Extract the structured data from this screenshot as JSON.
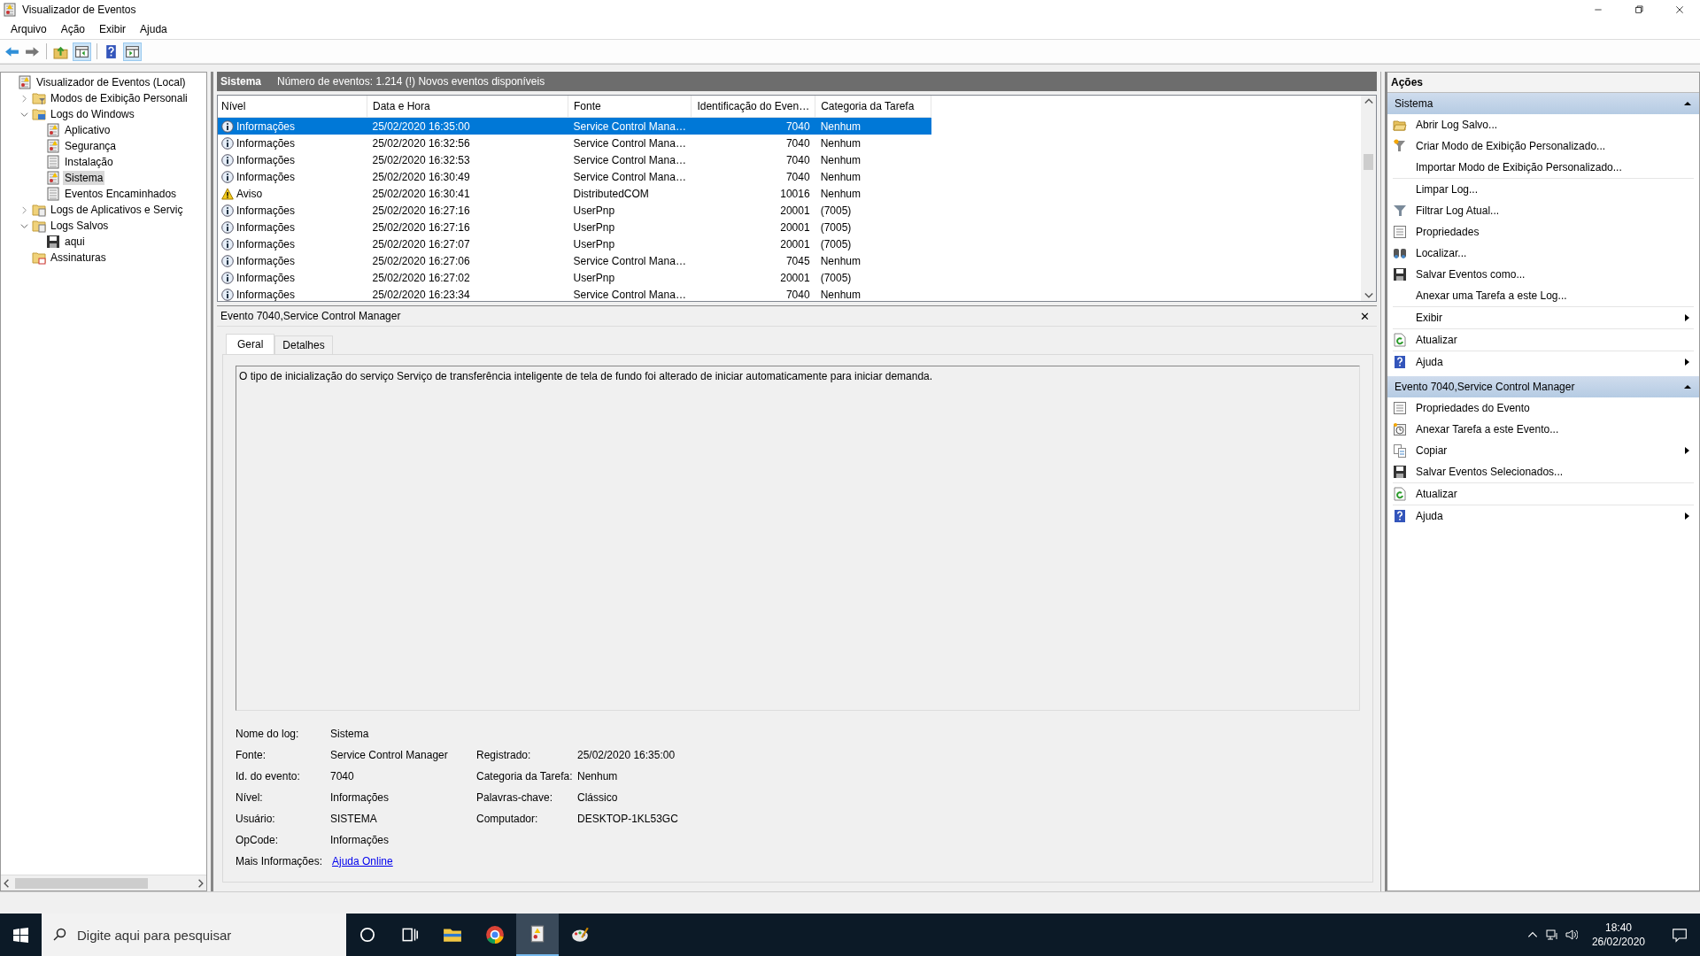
{
  "window": {
    "title": "Visualizador de Eventos"
  },
  "menu": [
    "Arquivo",
    "Ação",
    "Exibir",
    "Ajuda"
  ],
  "toolbar": [
    {
      "kind": "back"
    },
    {
      "kind": "forward"
    },
    {
      "kind": "sep"
    },
    {
      "kind": "folderup"
    },
    {
      "kind": "panelleft"
    },
    {
      "kind": "sep"
    },
    {
      "kind": "help"
    },
    {
      "kind": "panelright"
    }
  ],
  "tree": [
    {
      "label": "Visualizador de Eventos (Local)",
      "kind": "viewer",
      "selected": false,
      "children": [
        {
          "label": "Modos de Exibição Personali",
          "kind": "folderfilter",
          "expanded": false,
          "selected": false
        },
        {
          "label": "Logs do Windows",
          "kind": "folderpc",
          "expanded": true,
          "selected": false,
          "children": [
            {
              "label": "Aplicativo",
              "kind": "logalert",
              "selected": false
            },
            {
              "label": "Segurança",
              "kind": "logalert",
              "selected": false
            },
            {
              "label": "Instalação",
              "kind": "log",
              "selected": false
            },
            {
              "label": "Sistema",
              "kind": "logalert",
              "selected": true
            },
            {
              "label": "Eventos Encaminhados",
              "kind": "log",
              "selected": false
            }
          ]
        },
        {
          "label": "Logs de Aplicativos e Serviç",
          "kind": "folderwin",
          "expanded": false,
          "selected": false
        },
        {
          "label": "Logs Salvos",
          "kind": "folderlog",
          "expanded": true,
          "selected": false,
          "children": [
            {
              "label": "aqui",
              "kind": "save",
              "selected": false
            }
          ]
        },
        {
          "label": "Assinaturas",
          "kind": "foldersub",
          "selected": false
        }
      ]
    }
  ],
  "log_header": {
    "title": "Sistema",
    "info": "Número de eventos: 1.214 (!) Novos eventos disponíveis"
  },
  "table": {
    "columns": [
      "Nível",
      "Data e Hora",
      "Fonte",
      "Identificação do Even…",
      "Categoria da Tarefa"
    ],
    "rows": [
      {
        "kind": "info",
        "level": "Informações",
        "date": "25/02/2020 16:35:00",
        "source": "Service Control Mana…",
        "id": "7040",
        "category": "Nenhum",
        "selected": true
      },
      {
        "kind": "info",
        "level": "Informações",
        "date": "25/02/2020 16:32:56",
        "source": "Service Control Mana…",
        "id": "7040",
        "category": "Nenhum",
        "selected": false
      },
      {
        "kind": "info",
        "level": "Informações",
        "date": "25/02/2020 16:32:53",
        "source": "Service Control Mana…",
        "id": "7040",
        "category": "Nenhum",
        "selected": false
      },
      {
        "kind": "info",
        "level": "Informações",
        "date": "25/02/2020 16:30:49",
        "source": "Service Control Mana…",
        "id": "7040",
        "category": "Nenhum",
        "selected": false
      },
      {
        "kind": "warning",
        "level": "Aviso",
        "date": "25/02/2020 16:30:41",
        "source": "DistributedCOM",
        "id": "10016",
        "category": "Nenhum",
        "selected": false
      },
      {
        "kind": "info",
        "level": "Informações",
        "date": "25/02/2020 16:27:16",
        "source": "UserPnp",
        "id": "20001",
        "category": "(7005)",
        "selected": false
      },
      {
        "kind": "info",
        "level": "Informações",
        "date": "25/02/2020 16:27:16",
        "source": "UserPnp",
        "id": "20001",
        "category": "(7005)",
        "selected": false
      },
      {
        "kind": "info",
        "level": "Informações",
        "date": "25/02/2020 16:27:07",
        "source": "UserPnp",
        "id": "20001",
        "category": "(7005)",
        "selected": false
      },
      {
        "kind": "info",
        "level": "Informações",
        "date": "25/02/2020 16:27:06",
        "source": "Service Control Mana…",
        "id": "7045",
        "category": "Nenhum",
        "selected": false
      },
      {
        "kind": "info",
        "level": "Informações",
        "date": "25/02/2020 16:27:02",
        "source": "UserPnp",
        "id": "20001",
        "category": "(7005)",
        "selected": false
      },
      {
        "kind": "info",
        "level": "Informações",
        "date": "25/02/2020 16:23:34",
        "source": "Service Control Mana…",
        "id": "7040",
        "category": "Nenhum",
        "selected": false
      }
    ]
  },
  "event": {
    "title": "Evento 7040,Service Control Manager",
    "close": "✕",
    "tabs": [
      {
        "label": "Geral",
        "selected": true
      },
      {
        "label": "Detalhes",
        "selected": false
      }
    ],
    "description": "O tipo de inicialização do serviço Serviço de transferência inteligente de tela de fundo foi alterado de iniciar automaticamente para iniciar demanda.",
    "fields_left": [
      {
        "label": "Nome do log:",
        "value": "Sistema"
      },
      {
        "label": "Fonte:",
        "value": "Service Control Manager"
      },
      {
        "label": "Id. do evento:",
        "value": "7040"
      },
      {
        "label": "Nível:",
        "value": "Informações"
      },
      {
        "label": "Usuário:",
        "value": "SISTEMA"
      },
      {
        "label": "OpCode:",
        "value": "Informações"
      }
    ],
    "fields_right": [
      {
        "label": "Registrado:",
        "value": "25/02/2020 16:35:00"
      },
      {
        "label": "Categoria da Tarefa:",
        "value": "Nenhum"
      },
      {
        "label": "Palavras-chave:",
        "value": "Clássico"
      },
      {
        "label": "Computador:",
        "value": "DESKTOP-1KL53GC"
      }
    ],
    "more_info": {
      "label": "Mais Informações:",
      "link": "Ajuda Online"
    }
  },
  "actions": {
    "title": "Ações",
    "sections": [
      {
        "title": "Sistema",
        "expanded": true,
        "groups": [
          [
            {
              "label": "Abrir Log Salvo...",
              "kind": "folder",
              "submenu": false
            },
            {
              "label": "Criar Modo de Exibição Personalizado...",
              "kind": "funnelstar",
              "submenu": false
            },
            {
              "label": "Importar Modo de Exibição Personalizado...",
              "kind": "plain",
              "submenu": false
            }
          ],
          [
            {
              "label": "Limpar Log...",
              "kind": "plain",
              "submenu": false
            },
            {
              "label": "Filtrar Log Atual...",
              "kind": "funnel",
              "submenu": false
            },
            {
              "label": "Propriedades",
              "kind": "properties",
              "submenu": false
            },
            {
              "label": "Localizar...",
              "kind": "binoculars",
              "submenu": false
            },
            {
              "label": "Salvar Eventos como...",
              "kind": "save",
              "submenu": false
            },
            {
              "label": "Anexar uma Tarefa a este Log...",
              "kind": "plain",
              "submenu": false
            }
          ],
          [
            {
              "label": "Exibir",
              "kind": "plain",
              "submenu": true
            }
          ],
          [
            {
              "label": "Atualizar",
              "kind": "refresh",
              "submenu": false
            }
          ],
          [
            {
              "label": "Ajuda",
              "kind": "help",
              "submenu": true
            }
          ]
        ]
      },
      {
        "title": "Evento 7040,Service Control Manager",
        "expanded": true,
        "groups": [
          [
            {
              "label": "Propriedades do Evento",
              "kind": "properties",
              "submenu": false
            },
            {
              "label": "Anexar Tarefa a este Evento...",
              "kind": "task",
              "submenu": false
            },
            {
              "label": "Copiar",
              "kind": "copy",
              "submenu": true
            },
            {
              "label": "Salvar Eventos Selecionados...",
              "kind": "save",
              "submenu": false
            }
          ],
          [
            {
              "label": "Atualizar",
              "kind": "refresh",
              "submenu": false
            }
          ],
          [
            {
              "label": "Ajuda",
              "kind": "help",
              "submenu": true
            }
          ]
        ]
      }
    ]
  },
  "taskbar": {
    "search_placeholder": "Digite aqui para pesquisar",
    "apps": [
      {
        "kind": "cortana",
        "active": false
      },
      {
        "kind": "taskview",
        "active": false
      },
      {
        "kind": "explorer",
        "active": false
      },
      {
        "kind": "chrome",
        "active": false
      },
      {
        "kind": "eventviewer",
        "active": true
      },
      {
        "kind": "paint",
        "active": false
      }
    ],
    "time": "18:40",
    "date": "26/02/2020"
  }
}
